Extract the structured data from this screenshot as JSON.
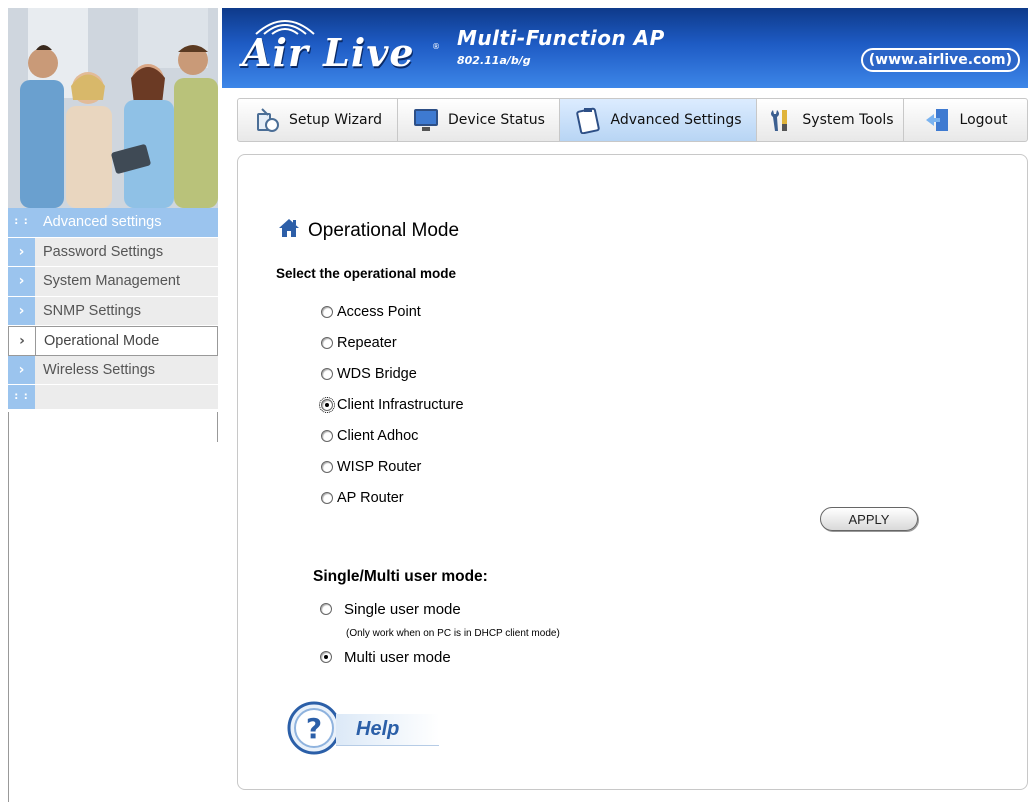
{
  "brand": {
    "logo": "Air Live",
    "registered_mark": "®",
    "product_title": "Multi-Function AP",
    "product_subtitle": "802.11a/b/g",
    "website": "(www.airlive.com)"
  },
  "nav": {
    "items": [
      {
        "label": "Setup Wizard",
        "icon": "wizard-icon",
        "active": false
      },
      {
        "label": "Device Status",
        "icon": "monitor-icon",
        "active": false
      },
      {
        "label": "Advanced Settings",
        "icon": "notepad-icon",
        "active": true
      },
      {
        "label": "System Tools",
        "icon": "tools-icon",
        "active": false
      },
      {
        "label": "Logout",
        "icon": "logout-door-icon",
        "active": false
      }
    ]
  },
  "sidebar": {
    "header": "Advanced settings",
    "items": [
      {
        "label": "Password Settings",
        "active": false
      },
      {
        "label": "System Management",
        "active": false
      },
      {
        "label": "SNMP Settings",
        "active": false
      },
      {
        "label": "Operational Mode",
        "active": true
      },
      {
        "label": "Wireless Settings",
        "active": false
      }
    ]
  },
  "page": {
    "title": "Operational Mode",
    "title_icon": "home-icon",
    "select_label": "Select the operational mode",
    "modes": [
      {
        "label": "Access Point",
        "checked": false
      },
      {
        "label": "Repeater",
        "checked": false
      },
      {
        "label": "WDS Bridge",
        "checked": false
      },
      {
        "label": "Client Infrastructure",
        "checked": true
      },
      {
        "label": "Client Adhoc",
        "checked": false
      },
      {
        "label": "WISP Router",
        "checked": false
      },
      {
        "label": "AP Router",
        "checked": false
      }
    ],
    "apply_label": "APPLY",
    "user_mode_label": "Single/Multi user mode:",
    "single_user_label": "Single user mode",
    "single_user_note": "(Only work when on PC is in DHCP client mode)",
    "multi_user_label": "Multi user mode",
    "user_mode_selected": "multi",
    "help_label": "Help",
    "help_icon": "question-mark-icon"
  },
  "colors": {
    "banner": "#1e5bc4",
    "sidebar_accent": "#9bc4ee",
    "nav_active": "#b8d5f4",
    "help_text": "#2b5fa8"
  }
}
